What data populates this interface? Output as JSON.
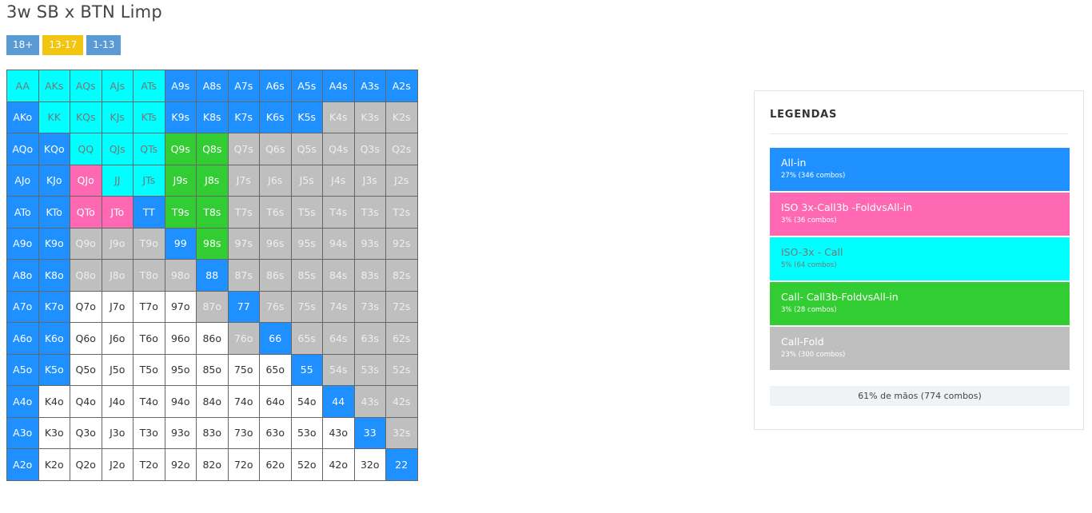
{
  "title": "3w SB x BTN Limp",
  "stack_tabs": [
    {
      "label": "18+",
      "color": "#5b9bd5"
    },
    {
      "label": "13-17",
      "color": "#f2c511"
    },
    {
      "label": "1-13",
      "color": "#5b9bd5"
    }
  ],
  "colors": {
    "all_in": "#1e90ff",
    "iso_3x_call3b_fold": "#ff69b4",
    "iso_3x_call": "#00ffff",
    "call_call3b_fold": "#32cd32",
    "call_fold": "#bfbfbf",
    "not_played": "#ffffff"
  },
  "grid": {
    "rows": [
      [
        "AA",
        "AKs",
        "AQs",
        "AJs",
        "ATs",
        "A9s",
        "A8s",
        "A7s",
        "A6s",
        "A5s",
        "A4s",
        "A3s",
        "A2s"
      ],
      [
        "AKo",
        "KK",
        "KQs",
        "KJs",
        "KTs",
        "K9s",
        "K8s",
        "K7s",
        "K6s",
        "K5s",
        "K4s",
        "K3s",
        "K2s"
      ],
      [
        "AQo",
        "KQo",
        "QQ",
        "QJs",
        "QTs",
        "Q9s",
        "Q8s",
        "Q7s",
        "Q6s",
        "Q5s",
        "Q4s",
        "Q3s",
        "Q2s"
      ],
      [
        "AJo",
        "KJo",
        "QJo",
        "JJ",
        "JTs",
        "J9s",
        "J8s",
        "J7s",
        "J6s",
        "J5s",
        "J4s",
        "J3s",
        "J2s"
      ],
      [
        "ATo",
        "KTo",
        "QTo",
        "JTo",
        "TT",
        "T9s",
        "T8s",
        "T7s",
        "T6s",
        "T5s",
        "T4s",
        "T3s",
        "T2s"
      ],
      [
        "A9o",
        "K9o",
        "Q9o",
        "J9o",
        "T9o",
        "99",
        "98s",
        "97s",
        "96s",
        "95s",
        "94s",
        "93s",
        "92s"
      ],
      [
        "A8o",
        "K8o",
        "Q8o",
        "J8o",
        "T8o",
        "98o",
        "88",
        "87s",
        "86s",
        "85s",
        "84s",
        "83s",
        "82s"
      ],
      [
        "A7o",
        "K7o",
        "Q7o",
        "J7o",
        "T7o",
        "97o",
        "87o",
        "77",
        "76s",
        "75s",
        "74s",
        "73s",
        "72s"
      ],
      [
        "A6o",
        "K6o",
        "Q6o",
        "J6o",
        "T6o",
        "96o",
        "86o",
        "76o",
        "66",
        "65s",
        "64s",
        "63s",
        "62s"
      ],
      [
        "A5o",
        "K5o",
        "Q5o",
        "J5o",
        "T5o",
        "95o",
        "85o",
        "75o",
        "65o",
        "55",
        "54s",
        "53s",
        "52s"
      ],
      [
        "A4o",
        "K4o",
        "Q4o",
        "J4o",
        "T4o",
        "94o",
        "84o",
        "74o",
        "64o",
        "54o",
        "44",
        "43s",
        "42s"
      ],
      [
        "A3o",
        "K3o",
        "Q3o",
        "J3o",
        "T3o",
        "93o",
        "83o",
        "73o",
        "63o",
        "53o",
        "43o",
        "33",
        "32s"
      ],
      [
        "A2o",
        "K2o",
        "Q2o",
        "J2o",
        "T2o",
        "92o",
        "82o",
        "72o",
        "62o",
        "52o",
        "42o",
        "32o",
        "22"
      ]
    ],
    "actions": [
      [
        "isocall",
        "isocall",
        "isocall",
        "isocall",
        "isocall",
        "allin",
        "allin",
        "allin",
        "allin",
        "allin",
        "allin",
        "allin",
        "allin"
      ],
      [
        "allin",
        "isocall",
        "isocall",
        "isocall",
        "isocall",
        "allin",
        "allin",
        "allin",
        "allin",
        "allin",
        "fold",
        "fold",
        "fold"
      ],
      [
        "allin",
        "allin",
        "isocall",
        "isocall",
        "isocall",
        "call",
        "call",
        "fold",
        "fold",
        "fold",
        "fold",
        "fold",
        "fold"
      ],
      [
        "allin",
        "allin",
        "iso",
        "isocall",
        "isocall",
        "call",
        "call",
        "fold",
        "fold",
        "fold",
        "fold",
        "fold",
        "fold"
      ],
      [
        "allin",
        "allin",
        "iso",
        "iso",
        "allin",
        "call",
        "call",
        "fold",
        "fold",
        "fold",
        "fold",
        "fold",
        "fold"
      ],
      [
        "allin",
        "allin",
        "fold",
        "fold",
        "fold",
        "allin",
        "call",
        "fold",
        "fold",
        "fold",
        "fold",
        "fold",
        "fold"
      ],
      [
        "allin",
        "allin",
        "fold",
        "fold",
        "fold",
        "fold",
        "allin",
        "fold",
        "fold",
        "fold",
        "fold",
        "fold",
        "fold"
      ],
      [
        "allin",
        "allin",
        "none",
        "none",
        "none",
        "none",
        "fold",
        "allin",
        "fold",
        "fold",
        "fold",
        "fold",
        "fold"
      ],
      [
        "allin",
        "allin",
        "none",
        "none",
        "none",
        "none",
        "none",
        "fold",
        "allin",
        "fold",
        "fold",
        "fold",
        "fold"
      ],
      [
        "allin",
        "allin",
        "none",
        "none",
        "none",
        "none",
        "none",
        "none",
        "none",
        "allin",
        "fold",
        "fold",
        "fold"
      ],
      [
        "allin",
        "none",
        "none",
        "none",
        "none",
        "none",
        "none",
        "none",
        "none",
        "none",
        "allin",
        "fold",
        "fold"
      ],
      [
        "allin",
        "none",
        "none",
        "none",
        "none",
        "none",
        "none",
        "none",
        "none",
        "none",
        "none",
        "allin",
        "fold"
      ],
      [
        "allin",
        "none",
        "none",
        "none",
        "none",
        "none",
        "none",
        "none",
        "none",
        "none",
        "none",
        "none",
        "allin"
      ]
    ]
  },
  "legend": {
    "title": "LEGENDAS",
    "items": [
      {
        "key": "allin",
        "name": "All-in",
        "sub": "27% (346 combos)",
        "color": "#1e90ff",
        "text_color": "#ffffff"
      },
      {
        "key": "iso",
        "name": "ISO 3x-Call3b -FoldvsAll-in",
        "sub": "3% (36 combos)",
        "color": "#ff69b4",
        "text_color": "#ffffff"
      },
      {
        "key": "isocall",
        "name": "ISO-3x - Call",
        "sub": "5% (64 combos)",
        "color": "#00ffff",
        "text_color": "#777777"
      },
      {
        "key": "call",
        "name": "Call- Call3b-FoldvsAll-in",
        "sub": "3% (28 combos)",
        "color": "#32cd32",
        "text_color": "#ffffff"
      },
      {
        "key": "fold",
        "name": "Call-Fold",
        "sub": "23% (300 combos)",
        "color": "#bfbfbf",
        "text_color": "#ffffff"
      }
    ],
    "summary": "61% de mãos (774 combos)"
  }
}
